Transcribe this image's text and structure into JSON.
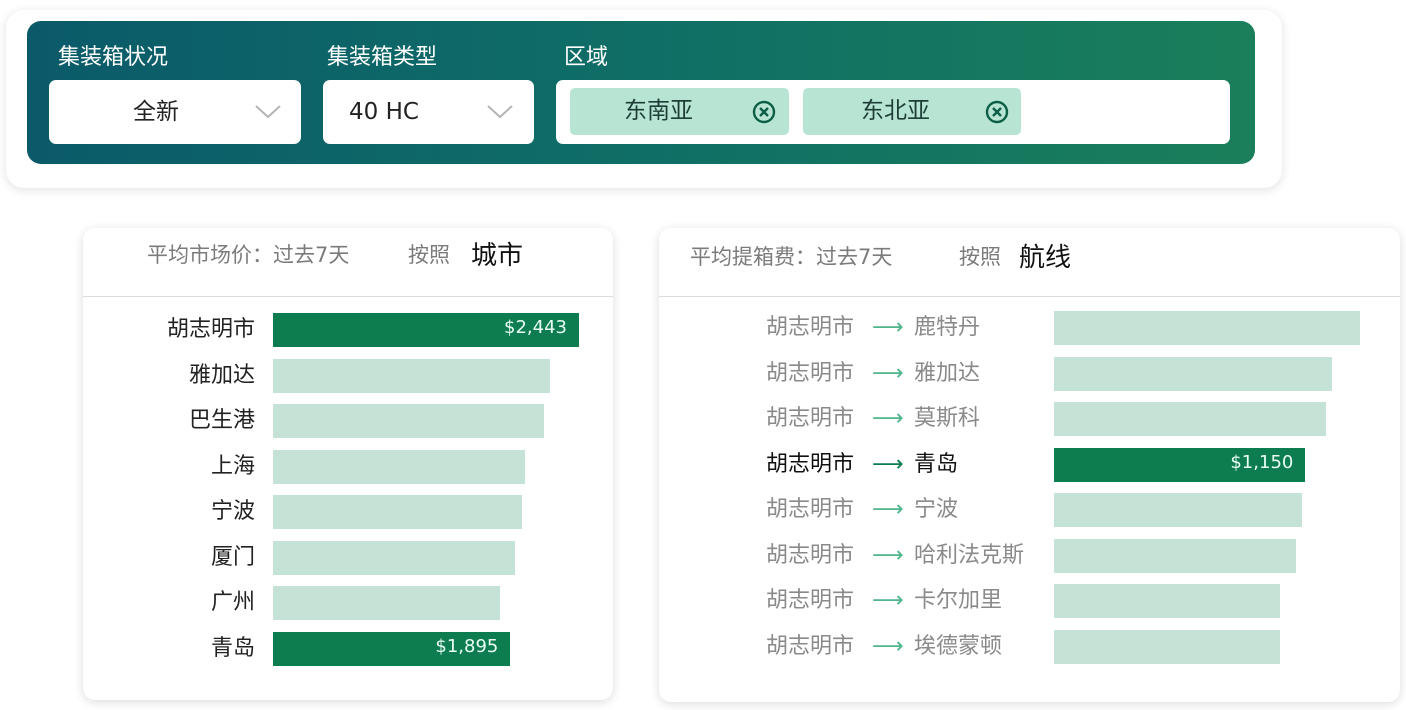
{
  "filters": {
    "container_status": {
      "label": "集装箱状况",
      "value": "全新",
      "icon": "chevron-down-icon"
    },
    "container_type": {
      "label": "集装箱类型",
      "value": "40 HC",
      "icon": "chevron-down-icon"
    },
    "region": {
      "label": "区域",
      "chips": [
        {
          "label": "东南亚",
          "icon": "remove-circle-icon"
        },
        {
          "label": "东北亚",
          "icon": "remove-circle-icon"
        }
      ]
    }
  },
  "city_panel": {
    "title": "平均市场价：过去7天",
    "by_label": "按照",
    "group": "城市",
    "rows": [
      {
        "label": "胡志明市",
        "value": 2443,
        "display": "$2,443",
        "highlight": true
      },
      {
        "label": "雅加达",
        "value": 2210,
        "display": "",
        "highlight": false
      },
      {
        "label": "巴生港",
        "value": 2165,
        "display": "",
        "highlight": false
      },
      {
        "label": "上海",
        "value": 2010,
        "display": "",
        "highlight": false
      },
      {
        "label": "宁波",
        "value": 1985,
        "display": "",
        "highlight": false
      },
      {
        "label": "厦门",
        "value": 1935,
        "display": "",
        "highlight": false
      },
      {
        "label": "广州",
        "value": 1810,
        "display": "",
        "highlight": false
      },
      {
        "label": "青岛",
        "value": 1895,
        "display": "$1,895",
        "highlight": true
      }
    ]
  },
  "route_panel": {
    "title": "平均提箱费：过去7天",
    "by_label": "按照",
    "group": "航线",
    "arrow": "⟶",
    "rows": [
      {
        "from": "胡志明市",
        "to": "鹿特丹",
        "value": 1400,
        "display": "",
        "highlight": false
      },
      {
        "from": "胡志明市",
        "to": "雅加达",
        "value": 1270,
        "display": "",
        "highlight": false
      },
      {
        "from": "胡志明市",
        "to": "莫斯科",
        "value": 1245,
        "display": "",
        "highlight": false
      },
      {
        "from": "胡志明市",
        "to": "青岛",
        "value": 1150,
        "display": "$1,150",
        "highlight": true
      },
      {
        "from": "胡志明市",
        "to": "宁波",
        "value": 1135,
        "display": "",
        "highlight": false
      },
      {
        "from": "胡志明市",
        "to": "哈利法克斯",
        "value": 1105,
        "display": "",
        "highlight": false
      },
      {
        "from": "胡志明市",
        "to": "卡尔加里",
        "value": 1035,
        "display": "",
        "highlight": false
      },
      {
        "from": "胡志明市",
        "to": "埃德蒙顿",
        "value": 1035,
        "display": "",
        "highlight": false
      }
    ]
  },
  "colors": {
    "accent_dark": "#0d7d4f",
    "bar_light": "#c4e3d6",
    "chip_bg": "#b7e4d3"
  }
}
